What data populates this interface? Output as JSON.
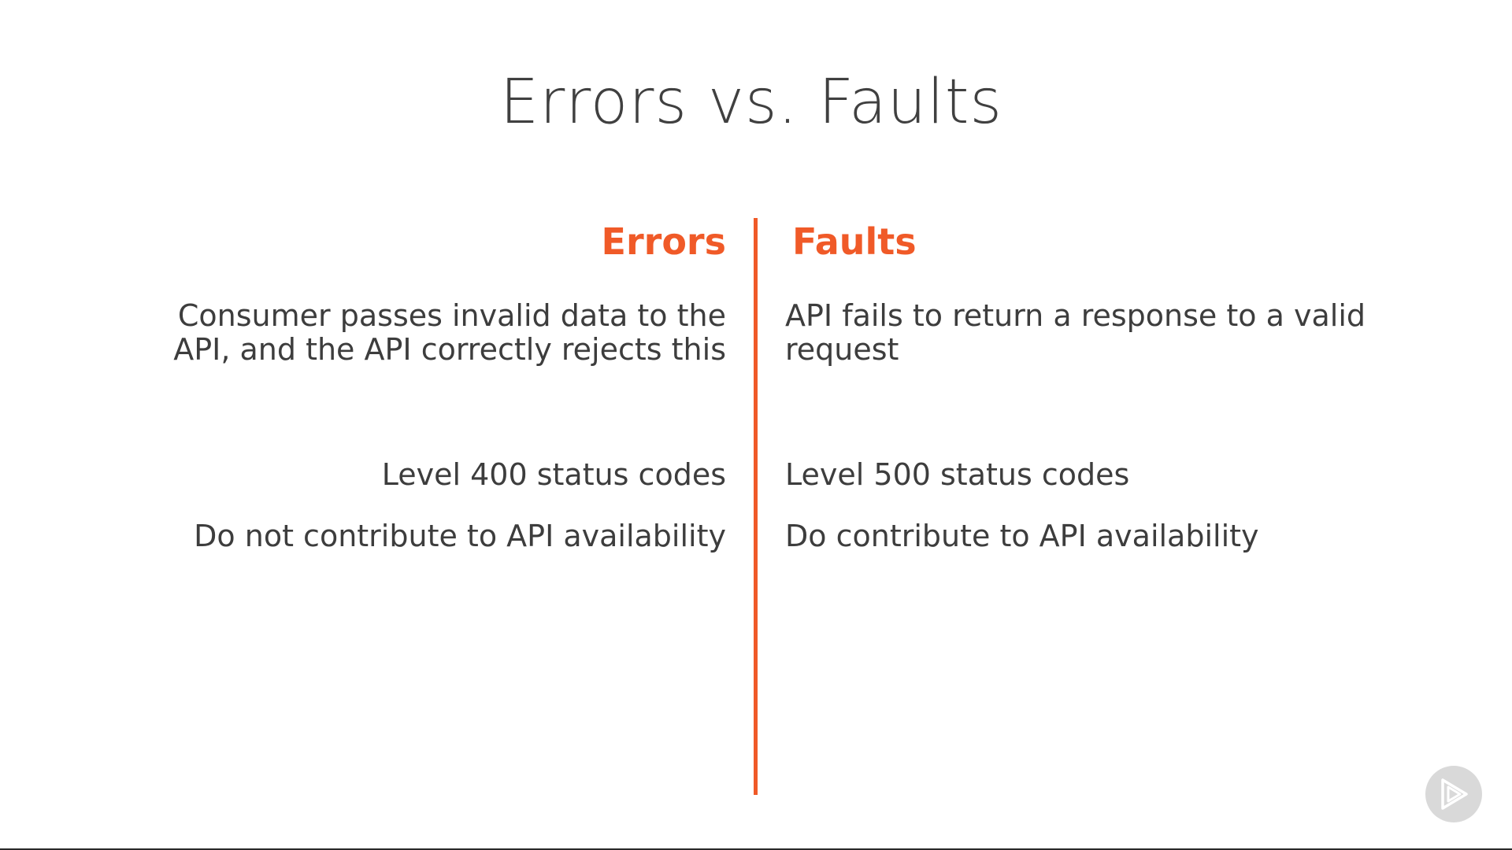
{
  "slide": {
    "title": "Errors vs. Faults",
    "accent_color": "#f05a28",
    "text_color": "#3d3d3d",
    "left": {
      "heading": "Errors",
      "items": [
        "Consumer passes invalid data to the API, and the API correctly rejects this",
        "Level 400 status codes",
        "Do not contribute to API availability"
      ]
    },
    "right": {
      "heading": "Faults",
      "items": [
        "API fails to return a response to a valid request",
        "Level 500 status codes",
        "Do contribute to API availability"
      ]
    }
  },
  "badge": {
    "icon": "play-logo-icon"
  }
}
